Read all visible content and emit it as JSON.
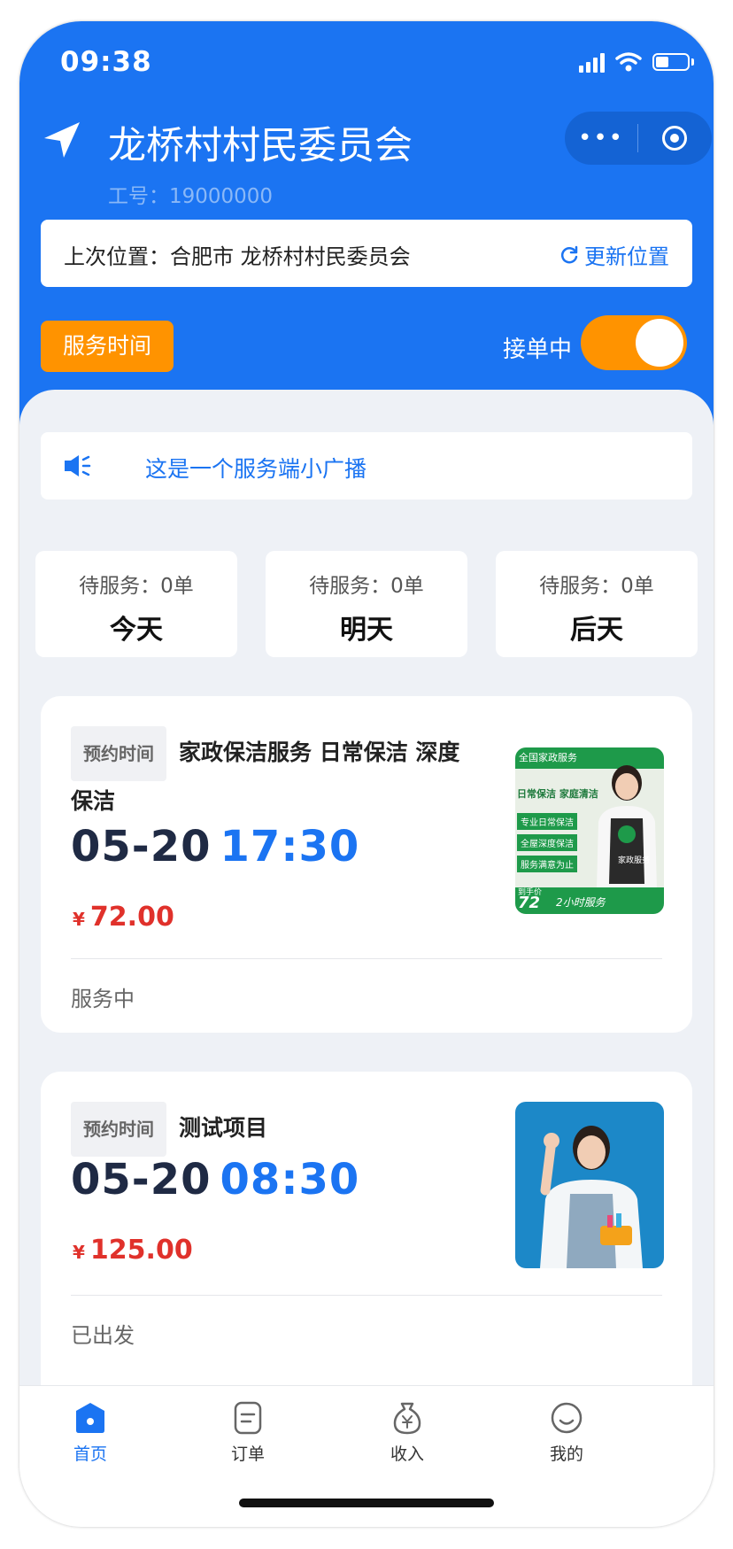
{
  "status_bar": {
    "time": "09:38"
  },
  "header": {
    "title": "龙桥村村民委员会",
    "staff_id": "工号：19000000",
    "capsule_more": "•••"
  },
  "location": {
    "last_location": "上次位置：合肥市 龙桥村村民委员会",
    "update_label": "更新位置"
  },
  "controls": {
    "service_time_label": "服务时间",
    "accepting_label": "接单中",
    "accepting_on": true
  },
  "broadcast": {
    "text": "这是一个服务端小广播"
  },
  "stats": [
    {
      "count": "待服务：0单",
      "day": "今天"
    },
    {
      "count": "待服务：0单",
      "day": "明天"
    },
    {
      "count": "待服务：0单",
      "day": "后天"
    }
  ],
  "orders": [
    {
      "badge": "预约时间",
      "title": "家政保洁服务 日常保洁 深度保洁",
      "date": "05-20",
      "time": "17:30",
      "currency": "¥",
      "price": "72.00",
      "status": "服务中",
      "image": {
        "line1": "全国家政服务",
        "line2": "日常保洁 家庭清洁",
        "item1": "专业日常保洁",
        "item2": "全屋深度保洁",
        "item3": "服务满意为止",
        "apron": "家政服务",
        "price_label": "到手价",
        "price": "72",
        "footer": "2小时服务"
      }
    },
    {
      "badge": "预约时间",
      "title": "测试项目",
      "date": "05-20",
      "time": "08:30",
      "currency": "¥",
      "price": "125.00",
      "status": "已出发"
    }
  ],
  "tabbar": [
    {
      "label": "首页",
      "icon": "home-icon",
      "active": true
    },
    {
      "label": "订单",
      "icon": "order-icon",
      "active": false
    },
    {
      "label": "收入",
      "icon": "income-icon",
      "active": false
    },
    {
      "label": "我的",
      "icon": "profile-icon",
      "active": false
    }
  ],
  "colors": {
    "primary": "#1b74f2",
    "accent": "#ff9300",
    "price": "#e0312b"
  }
}
